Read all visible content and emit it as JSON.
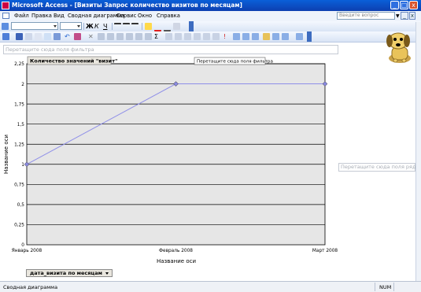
{
  "window": {
    "title": "Microsoft Access - [Визиты Запрос количество визитов по месяцам]",
    "buttons": [
      "_",
      "□",
      "x"
    ]
  },
  "menu": {
    "items": [
      "Файл",
      "Правка",
      "Вид",
      "Сводная диаграмма",
      "Сервис",
      "Окно",
      "Справка"
    ],
    "ask_placeholder": "Введите вопрос",
    "doc_buttons": [
      "_",
      "□",
      "x"
    ]
  },
  "pivot": {
    "filter_drop_zone": "Перетащите сюда поля фильтра",
    "filter_drop_zone_tooltip": "Перетащите сюда поля фильтра",
    "series_drop_zone": "Перетащите сюда поля рядов",
    "data_field": "Количество значений \"визит\"",
    "category_field": "дата_визита по месяцам"
  },
  "chart_data": {
    "type": "line",
    "categories": [
      "Январь 2008",
      "Февраль 2008",
      "Март 2008"
    ],
    "series": [
      {
        "values": [
          1,
          2,
          2
        ]
      }
    ],
    "xlabel": "Название оси",
    "ylabel": "Название оси",
    "ylim": [
      0,
      2.25
    ],
    "yticks": [
      "0",
      "0,25",
      "0,5",
      "0,75",
      "1",
      "1,25",
      "1,5",
      "1,75",
      "2",
      "2,25"
    ],
    "ytick_values": [
      0,
      0.25,
      0.5,
      0.75,
      1,
      1.25,
      1.5,
      1.75,
      2,
      2.25
    ],
    "grid": true,
    "colors": {
      "line": "#8f8fe8",
      "marker": "#8a8ae0",
      "plot_bg": "#e6e6e6",
      "grid": "#000000"
    }
  },
  "status": {
    "text": "Сводная диаграмма",
    "num": "NUM"
  }
}
